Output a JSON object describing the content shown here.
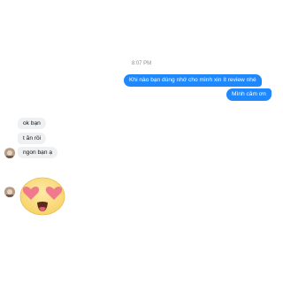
{
  "conversation": {
    "timestamp": "8:07 PM",
    "outgoing": [
      {
        "text": "Khi nào  bạn dùng nhớ cho mình xin ít review nhé"
      },
      {
        "text": "Mình cảm ơn"
      }
    ],
    "incoming": [
      {
        "text": "ok bạn"
      },
      {
        "text": "t ăn rồi"
      },
      {
        "text": "ngon bạn ạ"
      }
    ]
  },
  "colors": {
    "outgoing_bubble": "#1e88ff",
    "incoming_bubble": "#eef0f2"
  },
  "icons": {
    "sticker": "heart-eyes-emoji",
    "avatar": "user-avatar"
  }
}
